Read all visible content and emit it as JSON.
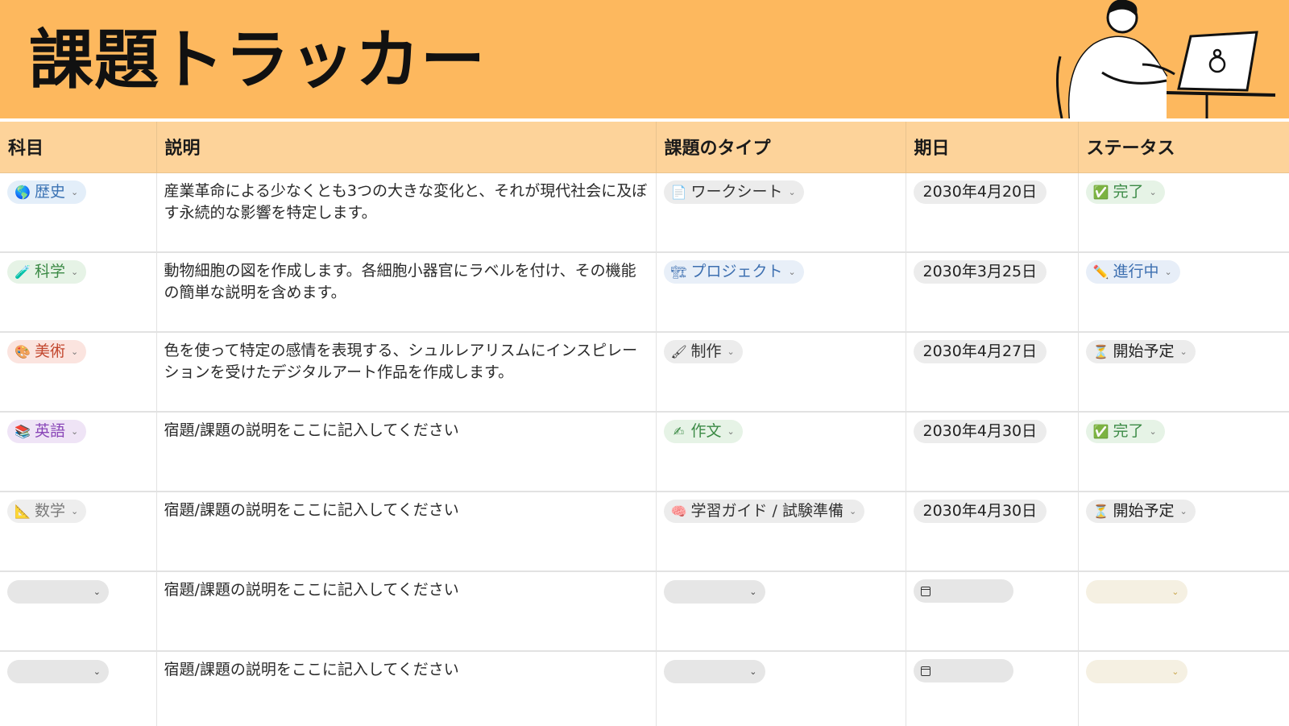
{
  "page": {
    "title": "課題トラッカー"
  },
  "columns": [
    "科目",
    "説明",
    "課題のタイプ",
    "期日",
    "ステータス"
  ],
  "rows": [
    {
      "subject": {
        "label": "歴史",
        "icon": "globe-icon",
        "glyph": "🌎",
        "color": "blue"
      },
      "description": "産業革命による少なくとも3つの大きな変化と、それが現代社会に及ぼす永続的な影響を特定します。",
      "type": {
        "label": "ワークシート",
        "icon": "document-icon",
        "glyph": "📄",
        "color": "gray"
      },
      "due": "2030年4月20日",
      "status": {
        "label": "完了",
        "icon": "check-mark-icon",
        "glyph": "✅",
        "color": "green"
      }
    },
    {
      "subject": {
        "label": "科学",
        "icon": "test-tube-icon",
        "glyph": "🧪",
        "color": "green"
      },
      "description": "動物細胞の図を作成します。各細胞小器官にラベルを付け、その機能の簡単な説明を含めます。",
      "type": {
        "label": "プロジェクト",
        "icon": "crane-icon",
        "glyph": "🏗",
        "color": "blue"
      },
      "due": "2030年3月25日",
      "status": {
        "label": "進行中",
        "icon": "pencil-icon",
        "glyph": "✏️",
        "color": "blue"
      }
    },
    {
      "subject": {
        "label": "美術",
        "icon": "palette-icon",
        "glyph": "🎨",
        "color": "red"
      },
      "description": "色を使って特定の感情を表現する、シュルレアリスムにインスピレーションを受けたデジタルアート作品を作成します。",
      "type": {
        "label": "制作",
        "icon": "paintbrush-icon",
        "glyph": "🖌",
        "color": "gray"
      },
      "due": "2030年4月27日",
      "status": {
        "label": "開始予定",
        "icon": "hourglass-icon",
        "glyph": "⏳",
        "color": "gray"
      }
    },
    {
      "subject": {
        "label": "英語",
        "icon": "books-icon",
        "glyph": "📚",
        "color": "purple"
      },
      "description": "宿題/課題の説明をここに記入してください",
      "type": {
        "label": "作文",
        "icon": "writing-hand-icon",
        "glyph": "✍",
        "color": "green"
      },
      "due": "2030年4月30日",
      "status": {
        "label": "完了",
        "icon": "check-mark-icon",
        "glyph": "✅",
        "color": "green"
      }
    },
    {
      "subject": {
        "label": "数学",
        "icon": "triangle-ruler-icon",
        "glyph": "📐",
        "color": "gray"
      },
      "description": "宿題/課題の説明をここに記入してください",
      "type": {
        "label": "学習ガイド / 試験準備",
        "icon": "brain-icon",
        "glyph": "🧠",
        "color": "gray"
      },
      "due": "2030年4月30日",
      "status": {
        "label": "開始予定",
        "icon": "hourglass-icon",
        "glyph": "⏳",
        "color": "gray"
      }
    },
    {
      "subject": null,
      "description": "宿題/課題の説明をここに記入してください",
      "type": null,
      "due": null,
      "status": null
    },
    {
      "subject": null,
      "description": "宿題/課題の説明をここに記入してください",
      "type": null,
      "due": null,
      "status": null
    }
  ],
  "colors": {
    "header_bg": "#fdb85e",
    "column_header_bg": "#fdd39a"
  }
}
